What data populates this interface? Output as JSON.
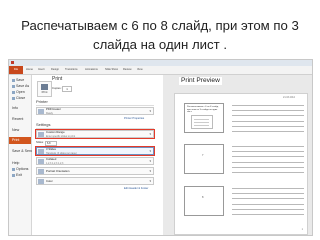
{
  "slide_title": {
    "line1": "Распечатываем с 6 по 8 слайд, при этом по 3",
    "line2": "слайда на один лист ."
  },
  "ribbon": {
    "tabs": [
      "File",
      "Home",
      "Insert",
      "Design",
      "Transitions",
      "Animations",
      "Slide Show",
      "Review",
      "View"
    ]
  },
  "nav": {
    "items": [
      {
        "label": "Save",
        "icon": "save-icon"
      },
      {
        "label": "Save As",
        "icon": "save-as-icon"
      },
      {
        "label": "Open",
        "icon": "open-icon"
      },
      {
        "label": "Close",
        "icon": "close-icon"
      },
      {
        "label": "Info",
        "icon": ""
      },
      {
        "label": "Recent",
        "icon": ""
      },
      {
        "label": "New",
        "icon": ""
      },
      {
        "label": "Print",
        "icon": ""
      },
      {
        "label": "Save & Send",
        "icon": ""
      },
      {
        "label": "Help",
        "icon": ""
      },
      {
        "label": "Options",
        "icon": "options-icon"
      },
      {
        "label": "Exit",
        "icon": "exit-icon"
      }
    ],
    "active": "Print"
  },
  "print_panel": {
    "heading": "Print",
    "print_button_label": "Print",
    "copies_label": "Copies:",
    "copies_value": "1",
    "printer_heading": "Printer",
    "printer_name": "PDFCreator",
    "printer_status": "Ready",
    "printer_properties": "Printer Properties",
    "settings_heading": "Settings",
    "range": {
      "title": "Custom Range",
      "subtitle": "Enter specific slides to print"
    },
    "slides_label": "Slides:",
    "slides_value": "6-8",
    "layout": {
      "title": "3 Slides",
      "subtitle": "Handouts (3 slides per page)"
    },
    "collate": {
      "title": "Collated",
      "subtitle": "1,2,3   1,2,3   1,2,3"
    },
    "orientation": {
      "title": "Portrait Orientation"
    },
    "color": {
      "title": "Color"
    },
    "footer_link": "Edit Header & Footer"
  },
  "preview": {
    "label": "Print Preview",
    "date": "21.03.2012",
    "thumbs": [
      {
        "title": "Распечатываем с 6 по 8 слайд, при этом по 3 слайда на один лист.",
        "num": ""
      },
      {
        "title": "",
        "num": "7"
      },
      {
        "title": "",
        "num": "8"
      }
    ],
    "page_number": "1"
  },
  "colors": {
    "file_tab": "#c8481c",
    "active_nav": "#d2561e",
    "highlight_frame": "#e23a2a"
  }
}
